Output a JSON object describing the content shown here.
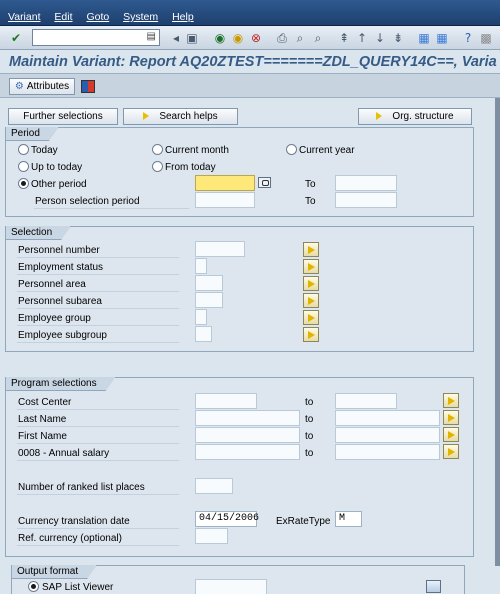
{
  "menubar": {
    "items": [
      "Variant",
      "Edit",
      "Goto",
      "System",
      "Help"
    ]
  },
  "title": "Maintain Variant: Report AQ20ZTEST=======ZDL_QUERY14C==, Varia",
  "appbar": {
    "attributes_label": "Attributes"
  },
  "tabs": {
    "further_selections": "Further selections",
    "search_helps": "Search helps",
    "org_structure": "Org. structure"
  },
  "period": {
    "label": "Period",
    "today": "Today",
    "current_month": "Current month",
    "current_year": "Current year",
    "up_to_today": "Up to today",
    "from_today": "From today",
    "other_period": "Other period",
    "person_selection_period": "Person selection period",
    "to1": "To",
    "to2": "To"
  },
  "selection": {
    "label": "Selection",
    "rows": [
      "Personnel number",
      "Employment status",
      "Personnel area",
      "Personnel subarea",
      "Employee group",
      "Employee subgroup"
    ]
  },
  "program": {
    "label": "Program selections",
    "rows": [
      "Cost Center",
      "Last Name",
      "First Name",
      "0008 - Annual salary"
    ],
    "to_label": "to",
    "ranked_label": "Number of ranked list places",
    "currency_date_label": "Currency translation date",
    "currency_date_value": "04/15/2006",
    "exrate_label": "ExRateType",
    "exrate_value": "M",
    "ref_currency_label": "Ref. currency (optional)"
  },
  "output": {
    "label": "Output format",
    "alv": "SAP List Viewer"
  }
}
